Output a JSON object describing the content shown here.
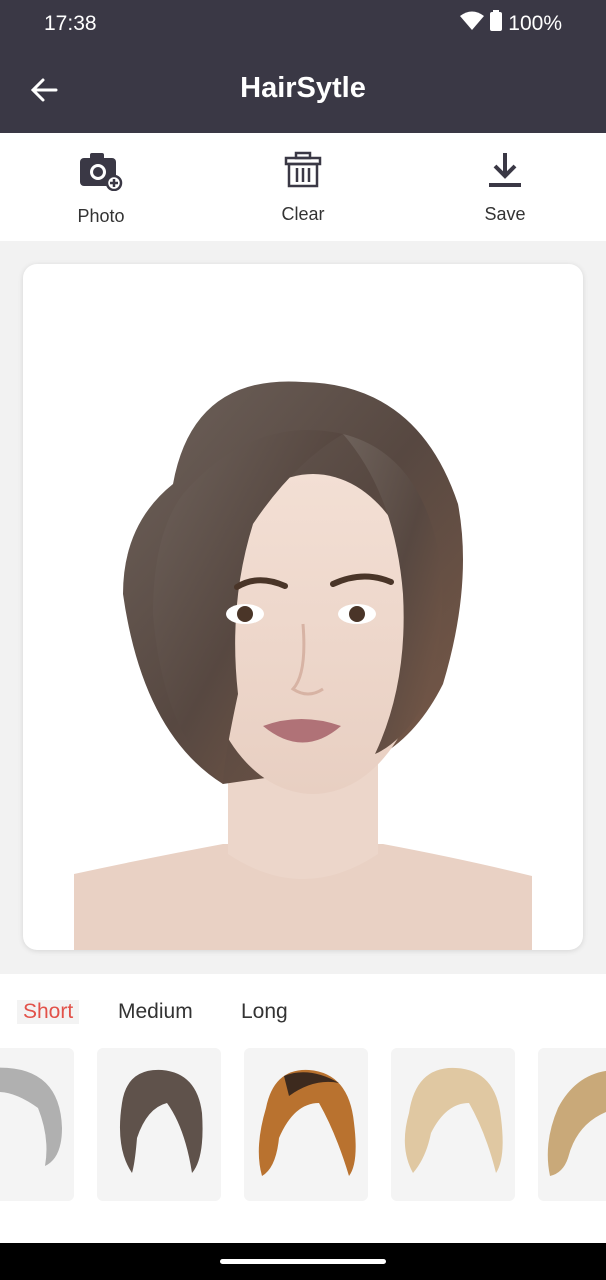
{
  "status_bar": {
    "time": "17:38",
    "battery": "100%"
  },
  "app_bar": {
    "title": "HairSytle",
    "back_icon": "arrow-left-icon"
  },
  "toolbar": {
    "photo_label": "Photo",
    "clear_label": "Clear",
    "save_label": "Save"
  },
  "categories": {
    "tabs": [
      "Short",
      "Medium",
      "Long"
    ],
    "selected": "Short"
  },
  "colors": {
    "app_bar": "#3a3845",
    "accent": "#e2524a"
  }
}
